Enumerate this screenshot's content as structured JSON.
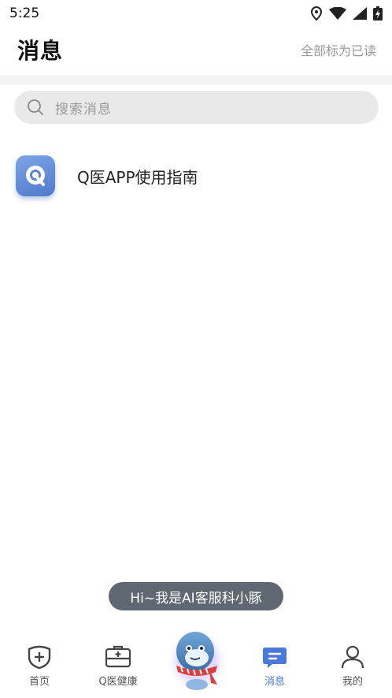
{
  "status_bar": {
    "time": "5:25"
  },
  "header": {
    "title": "消息",
    "mark_all_read": "全部标为已读"
  },
  "search": {
    "placeholder": "搜索消息"
  },
  "messages": [
    {
      "title": "Q医APP使用指南",
      "icon": "q-doctor-app-icon"
    }
  ],
  "toast": {
    "text": "Hi~我是AI客服科小豚"
  },
  "bottom_nav": {
    "items": [
      {
        "label": "首页",
        "icon": "home-shield-icon",
        "active": false
      },
      {
        "label": "Q医健康",
        "icon": "medical-kit-icon",
        "active": false
      },
      {
        "label": "",
        "icon": "ai-mascot-dolphin",
        "active": false
      },
      {
        "label": "消息",
        "icon": "message-bubble-icon",
        "active": true
      },
      {
        "label": "我的",
        "icon": "person-icon",
        "active": false
      }
    ]
  },
  "colors": {
    "accent": "#4a7ad9",
    "toast_bg": "#5f6772",
    "search_bg": "#e9e9e9",
    "secondary_text": "#9a9a9a"
  }
}
